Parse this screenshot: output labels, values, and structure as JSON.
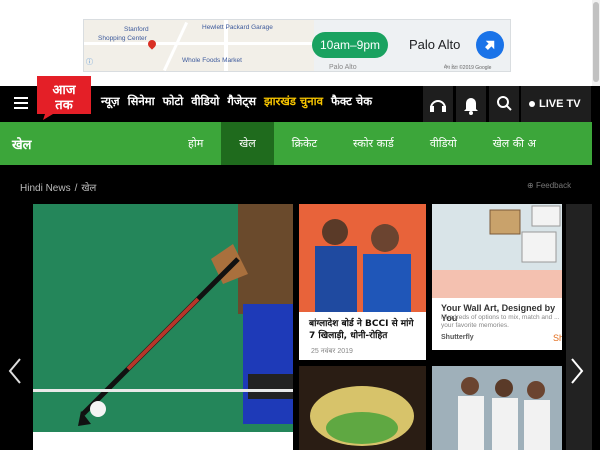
{
  "ad": {
    "hours": "10am–9pm",
    "place": "Palo Alto",
    "map_labels": [
      "Stanford",
      "Shopping Center",
      "Hewlett Packard Garage",
      "Whole Foods Market",
      "Palo Alto"
    ],
    "credits": "मैप डेटा ©2019 Google"
  },
  "header": {
    "nav": [
      "न्यूज़",
      "सिनेमा",
      "फोटो",
      "वीडियो",
      "गैजेट्स",
      "झारखंड चुनाव",
      "फैक्ट चेक"
    ],
    "live_label": "LIVE TV"
  },
  "section": {
    "title": "खेल",
    "tabs": [
      "होम",
      "खेल",
      "क्रिकेट",
      "स्कोर कार्ड",
      "वीडियो",
      "खेल की अ"
    ]
  },
  "breadcrumb": [
    "Hindi News",
    "खेल"
  ],
  "feedback_label": "Feedback",
  "cards": {
    "news_title": "बांग्लादेश बोर्ड ने BCCI से मांगे 7 खिलाड़ी, धोनी-रोहित",
    "news_date": "25 नवंबर 2019",
    "ad_title": "Your Wall Art, Designed by You",
    "ad_sub": "Hundreds of options to mix, match and ... your favorite memories.",
    "ad_brand": "Shutterfly",
    "ad_cta": "Sh"
  },
  "colors": {
    "brand_red": "#e41f27",
    "section_green": "#3ca63a",
    "active_tab": "#1f6b1d"
  }
}
